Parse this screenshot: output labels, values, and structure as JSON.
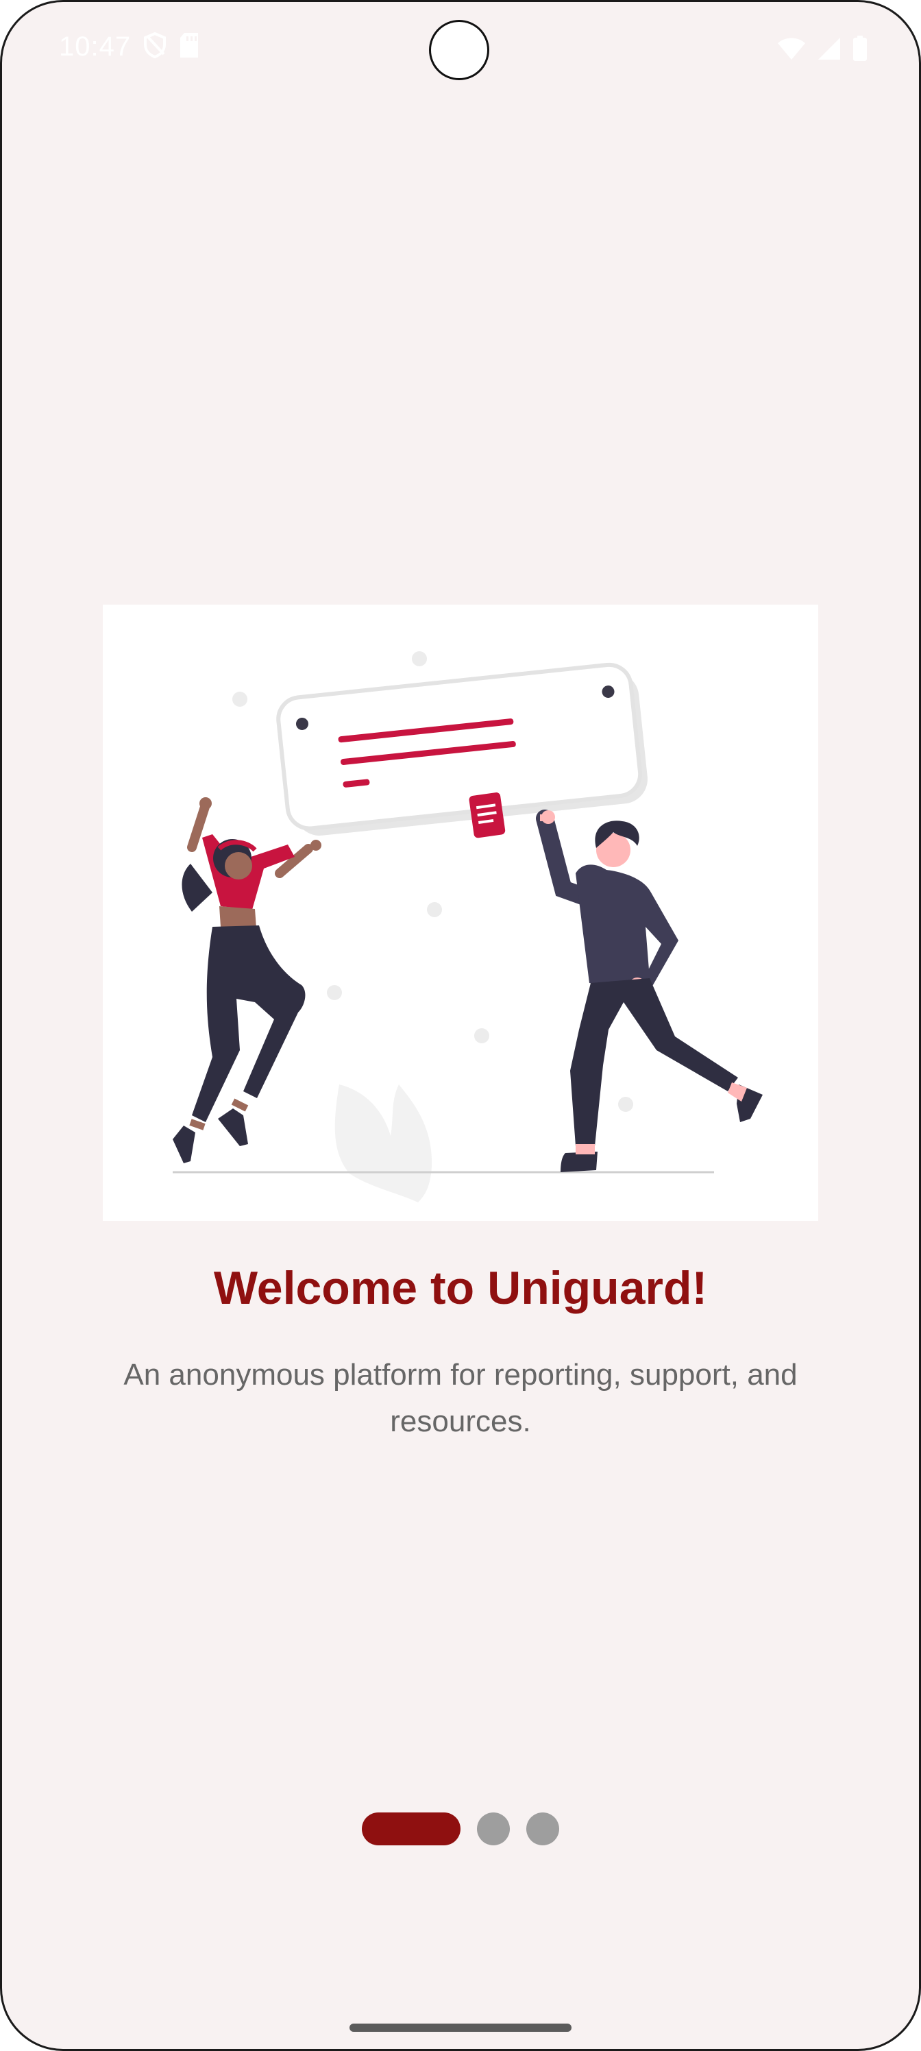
{
  "status_bar": {
    "time": "10:47",
    "left_icons": [
      "shield-icon",
      "sd-card-icon"
    ],
    "right_icons": [
      "wifi-icon",
      "cellular-signal-icon",
      "battery-icon"
    ]
  },
  "onboarding": {
    "illustration": "two-people-holding-sign-illustration",
    "title": "Welcome to Uniguard!",
    "description": "An anonymous platform for reporting, support, and resources."
  },
  "pager": {
    "page_count": 3,
    "active_index": 0
  },
  "colors": {
    "background": "#f8f2f2",
    "brand": "#8f1010",
    "accent": "#c8143f",
    "inactive_dot": "#9e9e9e",
    "body_text": "#666666"
  }
}
